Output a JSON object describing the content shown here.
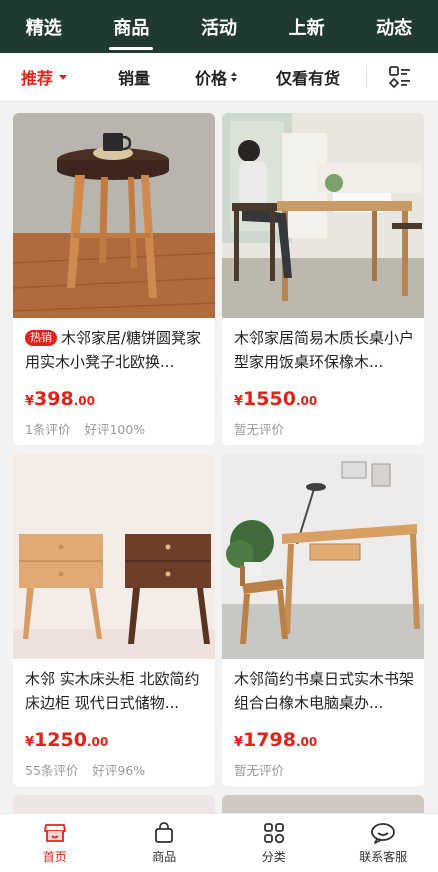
{
  "top_tabs": [
    "精选",
    "商品",
    "活动",
    "上新",
    "动态"
  ],
  "active_tab_index": 1,
  "filters": {
    "recommend": "推荐",
    "sales": "销量",
    "price": "价格",
    "in_stock": "仅看有货"
  },
  "products": [
    {
      "badge": "热销",
      "title": "木邻家居/糖饼圆凳家用实木小凳子北欧换...",
      "price_symbol": "¥",
      "price_int": "398",
      "price_dec": ".00",
      "reviews": "1条评价",
      "rating": "好评100%"
    },
    {
      "badge": "",
      "title": "木邻家居简易木质长桌小户型家用饭桌环保橡木...",
      "price_symbol": "¥",
      "price_int": "1550",
      "price_dec": ".00",
      "reviews": "暂无评价",
      "rating": ""
    },
    {
      "badge": "",
      "title": "木邻 实木床头柜 北欧简约床边柜 现代日式储物...",
      "price_symbol": "¥",
      "price_int": "1250",
      "price_dec": ".00",
      "reviews": "55条评价",
      "rating": "好评96%"
    },
    {
      "badge": "",
      "title": "木邻简约书桌日式实木书架组合白橡木电脑桌办...",
      "price_symbol": "¥",
      "price_int": "1798",
      "price_dec": ".00",
      "reviews": "暂无评价",
      "rating": ""
    }
  ],
  "bottom_nav": [
    "首页",
    "商品",
    "分类",
    "联系客服"
  ],
  "colors": {
    "accent": "#e2231a",
    "header_bg": "#1f3a2f"
  }
}
